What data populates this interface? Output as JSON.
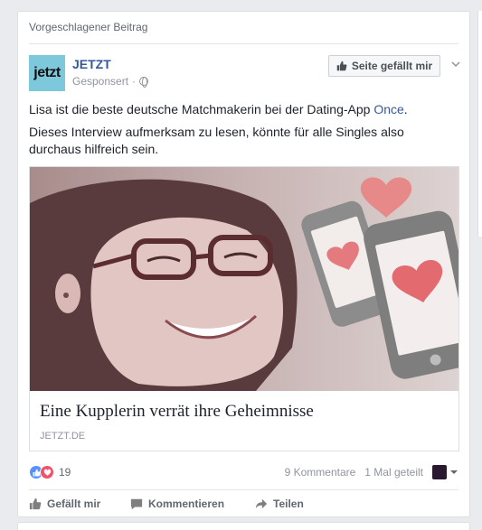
{
  "post": {
    "suggested_label": "Vorgeschlagener Beitrag",
    "page_name": "JETZT",
    "logo_text": "jetzt",
    "sponsored": "Gesponsert",
    "dot": "·",
    "like_page_button": "Seite gefällt mir",
    "text_line1_pre": "Lisa ist die beste deutsche Matchmakerin bei der Dating-App ",
    "text_line1_link": "Once",
    "text_line1_post": ".",
    "text_paragraph2": "Dieses Interview aufmerksam zu lesen, könnte für alle Singles also durchaus hilfreich sein."
  },
  "link_preview": {
    "title": "Eine Kupplerin verrät ihre Geheimnisse",
    "domain": "JETZT.DE"
  },
  "stats": {
    "reaction_count": "19",
    "comments": "9 Kommentare",
    "shares": "1 Mal geteilt"
  },
  "actions": {
    "like": "Gefällt mir",
    "comment": "Kommentieren",
    "share": "Teilen"
  },
  "colors": {
    "link": "#365899",
    "like_reaction": "#5890ff",
    "love_reaction": "#f25268",
    "logo_bg": "#7ec8dc",
    "image_tint": "#ccbcbc"
  }
}
